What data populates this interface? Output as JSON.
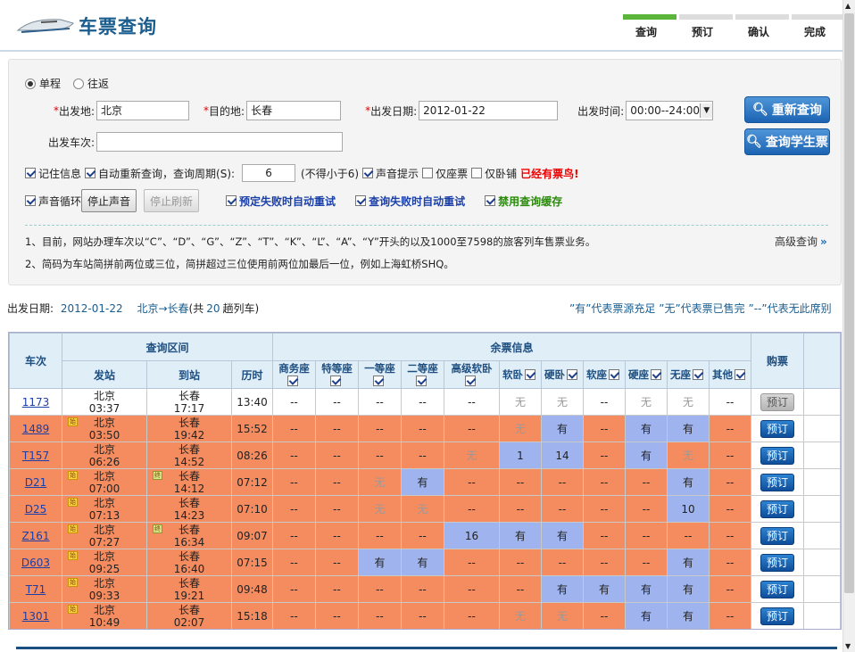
{
  "header": {
    "title": "车票查询",
    "steps": [
      "查询",
      "预订",
      "确认",
      "完成"
    ],
    "active_step": 0
  },
  "trip": {
    "one_way": "单程",
    "round_trip": "往返",
    "selected": "one_way"
  },
  "form": {
    "from_label": "出发地:",
    "from_value": "北京",
    "to_label": "目的地:",
    "to_value": "长春",
    "date_label": "出发日期:",
    "date_value": "2012-01-22",
    "time_label": "出发时间:",
    "time_value": "00:00--24:00",
    "train_label": "出发车次:",
    "train_value": "",
    "requery_button": "重新查询",
    "student_button": "查询学生票"
  },
  "options": {
    "remember": "记住信息",
    "auto_requery": "自动重新查询，查询周期(S):",
    "period": "6",
    "period_note": "(不得小于6)",
    "sound_prompt": "声音提示",
    "seat_only": "仅座票",
    "sleeper_only": "仅卧铺",
    "got_ticket": "已经有票鸟!",
    "sound_loop": "声音循环",
    "stop_sound": "停止声音",
    "stop_refresh": "停止刷新",
    "book_fail_retry": "预定失败时自动重试",
    "query_fail_retry": "查询失败时自动重试",
    "disable_cache": "禁用查询缓存"
  },
  "notes": [
    "1、目前，网站办理车次以“C”、“D”、“G”、“Z”、“T”、“K”、“L”、“A”、“Y”开头的以及1000至7598的旅客列车售票业务。",
    "2、简码为车站简拼前两位或三位，简拼超过三位使用前两位加最后一位，例如上海虹桥SHQ。"
  ],
  "advanced": "高级查询",
  "summary": {
    "label": "出发日期:",
    "date": "2012-01-22",
    "route": "北京→长春",
    "count_prefix": "(共",
    "count": "20",
    "count_suffix": "趟列车)"
  },
  "legend": "”有”代表票源充足  ”无”代表票已售完  ”--”代表无此席别",
  "table": {
    "headers": {
      "train": "车次",
      "range": "查询区间",
      "seats": "余票信息",
      "buy": "购票",
      "from": "发站",
      "to": "到站",
      "duration": "历时"
    },
    "seat_types": [
      "商务座",
      "特等座",
      "一等座",
      "二等座",
      "高级软卧",
      "软卧",
      "硬卧",
      "软座",
      "硬座",
      "无座",
      "其他"
    ],
    "book_label": "预订",
    "rows": [
      {
        "no": "1173",
        "from": "北京",
        "dep": "03:37",
        "to": "长春",
        "arr": "17:17",
        "dur": "13:40",
        "seats": [
          "--",
          "--",
          "--",
          "--",
          "--",
          "无",
          "无",
          "--",
          "无",
          "无",
          "--"
        ],
        "style": "w",
        "book_disabled": true,
        "from_tag": "",
        "to_tag": ""
      },
      {
        "no": "1489",
        "from": "北京",
        "dep": "03:50",
        "to": "长春",
        "arr": "19:42",
        "dur": "15:52",
        "seats": [
          "--",
          "--",
          "--",
          "--",
          "--",
          "无",
          "有",
          "--",
          "有",
          "有",
          "--"
        ],
        "style": "o",
        "from_tag": "始",
        "to_tag": ""
      },
      {
        "no": "T157",
        "from": "北京",
        "dep": "06:26",
        "to": "长春",
        "arr": "14:52",
        "dur": "08:26",
        "seats": [
          "--",
          "--",
          "--",
          "--",
          "无",
          "1",
          "14",
          "--",
          "有",
          "无",
          "--"
        ],
        "style": "o",
        "from_tag": "",
        "to_tag": ""
      },
      {
        "no": "D21",
        "from": "北京",
        "dep": "07:00",
        "to": "长春",
        "arr": "14:12",
        "dur": "07:12",
        "seats": [
          "--",
          "--",
          "无",
          "有",
          "--",
          "--",
          "--",
          "--",
          "--",
          "有",
          "--"
        ],
        "style": "o",
        "from_tag": "始",
        "to_tag": "终"
      },
      {
        "no": "D25",
        "from": "北京",
        "dep": "07:13",
        "to": "长春",
        "arr": "14:23",
        "dur": "07:10",
        "seats": [
          "--",
          "--",
          "无",
          "无",
          "--",
          "--",
          "--",
          "--",
          "--",
          "10",
          "--"
        ],
        "style": "o",
        "from_tag": "始",
        "to_tag": ""
      },
      {
        "no": "Z161",
        "from": "北京",
        "dep": "07:27",
        "to": "长春",
        "arr": "16:34",
        "dur": "09:07",
        "seats": [
          "--",
          "--",
          "--",
          "--",
          "16",
          "有",
          "有",
          "--",
          "--",
          "--",
          "--"
        ],
        "style": "o",
        "from_tag": "始",
        "to_tag": "终"
      },
      {
        "no": "D603",
        "from": "北京",
        "dep": "09:25",
        "to": "长春",
        "arr": "16:40",
        "dur": "07:15",
        "seats": [
          "--",
          "--",
          "有",
          "有",
          "--",
          "--",
          "--",
          "--",
          "--",
          "有",
          "--"
        ],
        "style": "o",
        "from_tag": "始",
        "to_tag": ""
      },
      {
        "no": "T71",
        "from": "北京",
        "dep": "09:33",
        "to": "长春",
        "arr": "19:21",
        "dur": "09:48",
        "seats": [
          "--",
          "--",
          "--",
          "--",
          "--",
          "--",
          "有",
          "有",
          "有",
          "有",
          "--"
        ],
        "style": "o",
        "from_tag": "始",
        "to_tag": ""
      },
      {
        "no": "1301",
        "from": "北京",
        "dep": "10:49",
        "to": "长春",
        "arr": "02:07",
        "dur": "15:18",
        "seats": [
          "--",
          "--",
          "--",
          "--",
          "--",
          "无",
          "无",
          "--",
          "有",
          "有",
          "--"
        ],
        "style": "o",
        "from_tag": "始",
        "to_tag": ""
      }
    ]
  }
}
